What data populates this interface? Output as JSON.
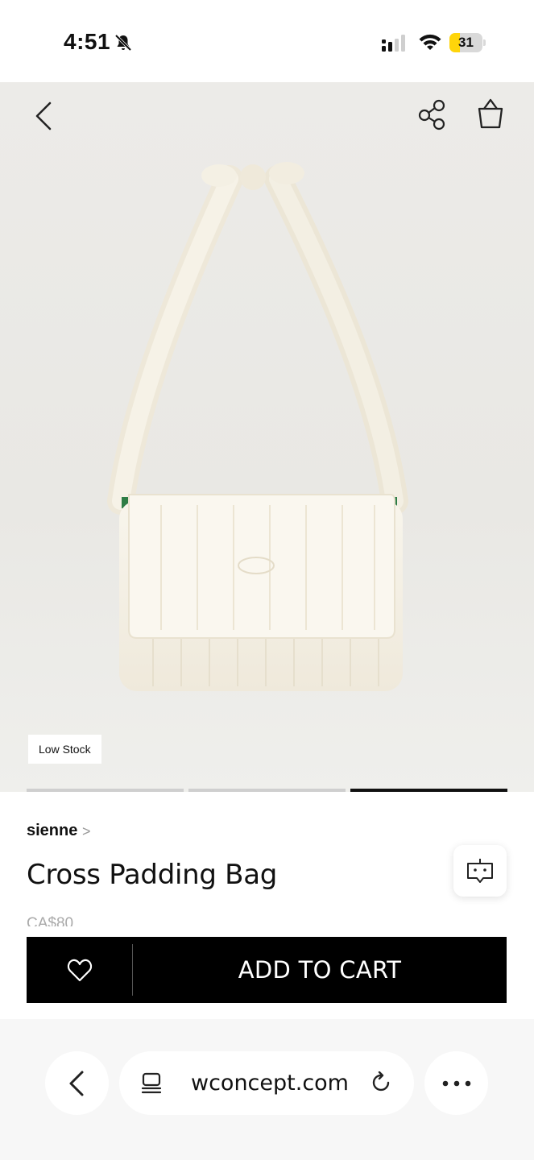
{
  "status_bar": {
    "time": "4:51",
    "battery": "31",
    "battery_level": 0.31,
    "icons": [
      "bell-slash-icon",
      "cellular-signal-icon",
      "wifi-icon",
      "battery-icon"
    ]
  },
  "header": {
    "icons": [
      "back-chevron-icon",
      "share-icon",
      "shopping-basket-icon"
    ]
  },
  "gallery": {
    "badge": "Low Stock",
    "page_count": 3,
    "active_page": 3
  },
  "product": {
    "brand": "sienne",
    "brand_chevron": ">",
    "name": "Cross Padding Bag",
    "price": "CA$80"
  },
  "cart_bar": {
    "wishlist_icon": "heart-icon",
    "add_to_cart_label": "ADD TO CART"
  },
  "chatbot": {
    "icon": "chatbot-icon"
  },
  "browser": {
    "url": "wconcept.com",
    "icons": [
      "back-chevron-icon",
      "tabs-icon",
      "reload-icon",
      "more-icon"
    ]
  },
  "colors": {
    "cart_bar_bg": "#000000",
    "battery_fill": "#ffd50a",
    "pager_active": "#111111",
    "pager_inactive": "#cfcfcf"
  }
}
